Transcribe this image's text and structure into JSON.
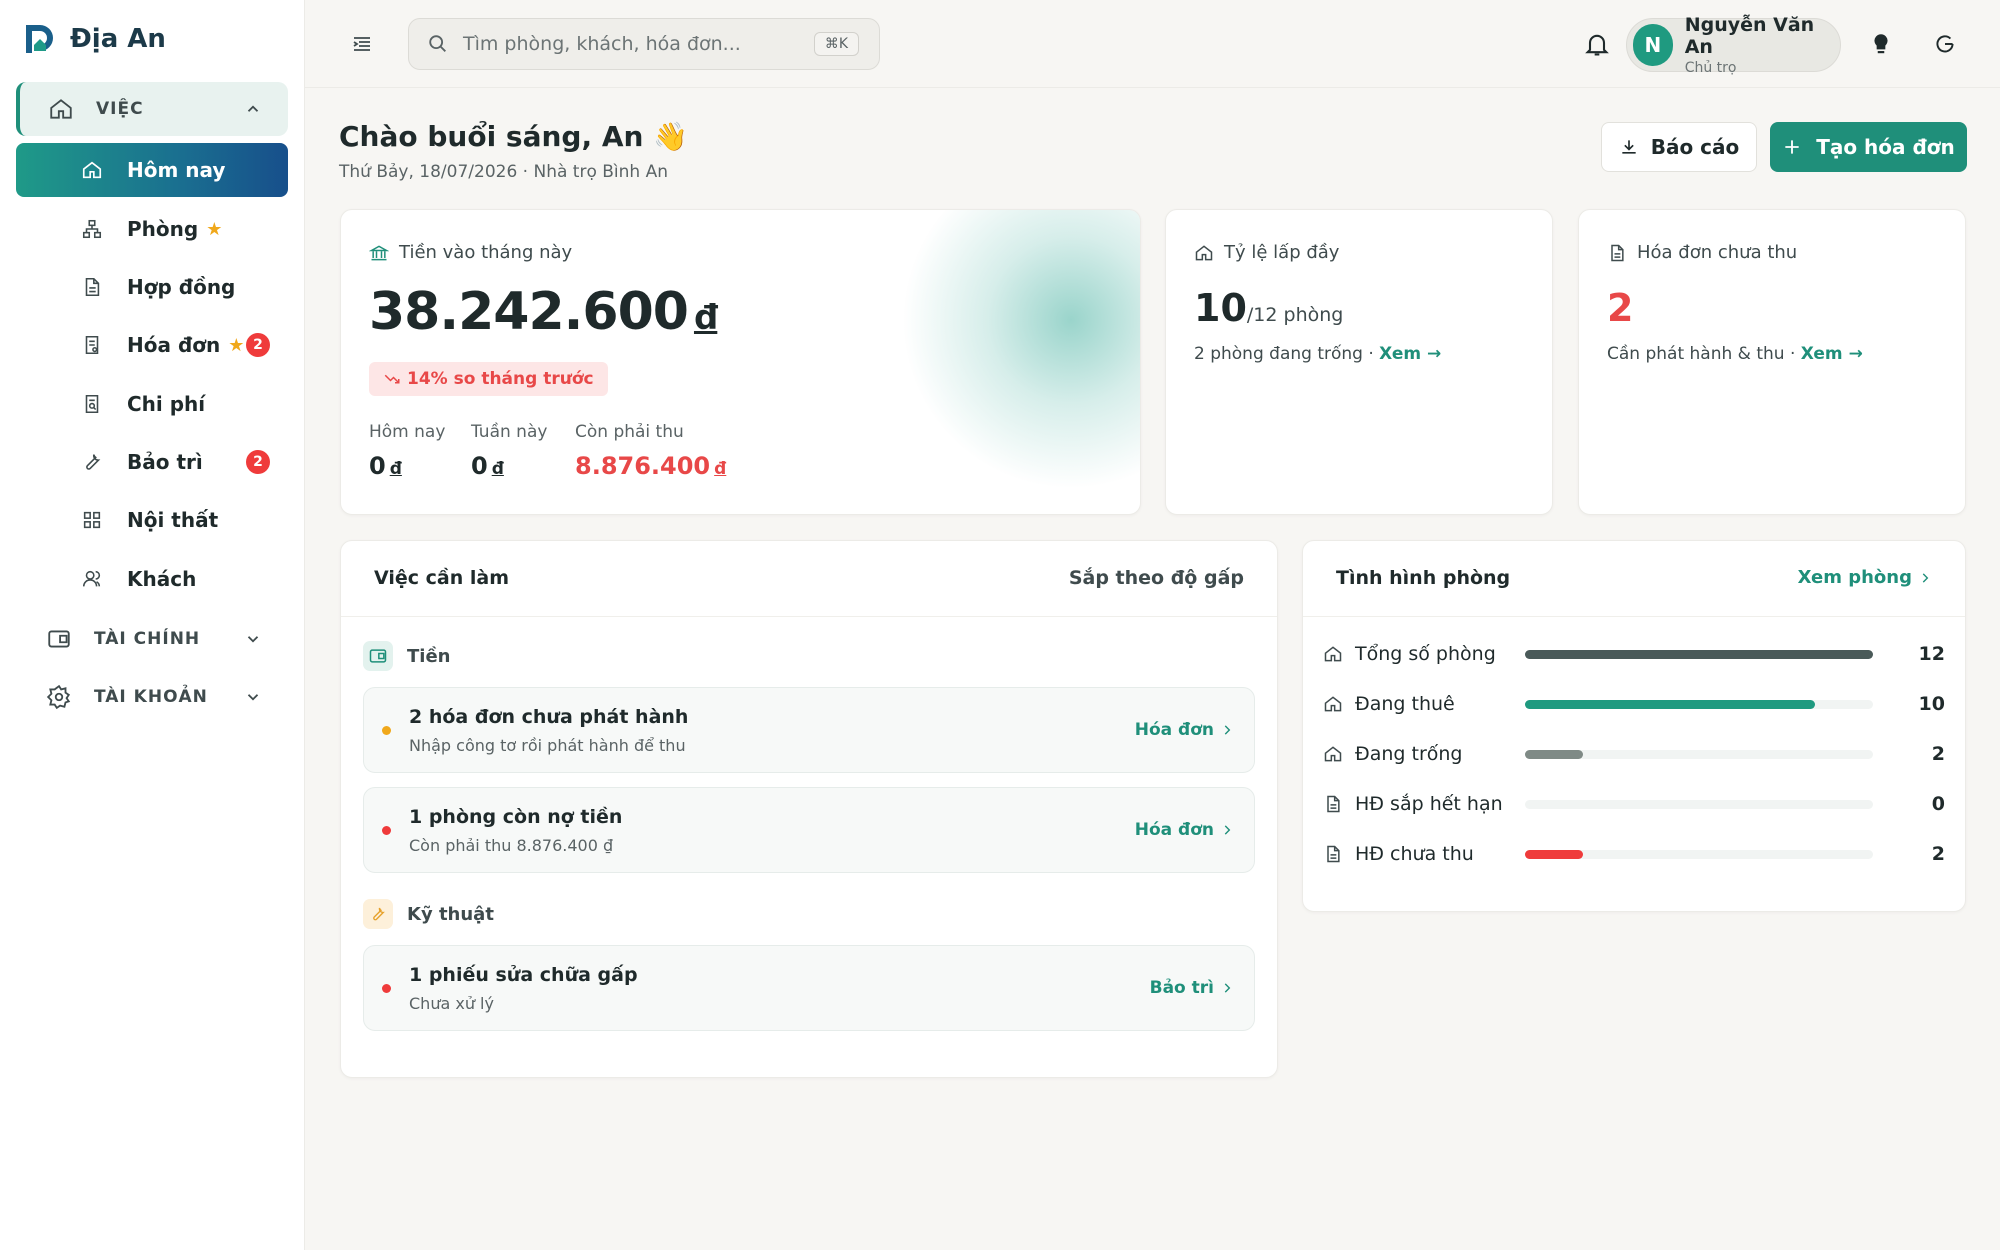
{
  "app": {
    "name": "Địa An"
  },
  "sidebar": {
    "sections": [
      {
        "label": "VIỆC"
      },
      {
        "label": "TÀI CHÍNH"
      },
      {
        "label": "TÀI KHOẢN"
      }
    ],
    "items": [
      {
        "label": "Hôm nay"
      },
      {
        "label": "Phòng",
        "starred": true
      },
      {
        "label": "Hợp đồng"
      },
      {
        "label": "Hóa đơn",
        "starred": true,
        "badge": "2"
      },
      {
        "label": "Chi phí"
      },
      {
        "label": "Bảo trì",
        "badge": "2"
      },
      {
        "label": "Nội thất"
      },
      {
        "label": "Khách"
      }
    ]
  },
  "header": {
    "search_placeholder": "Tìm phòng, khách, hóa đơn...",
    "shortcut": "⌘K",
    "user": {
      "initial": "N",
      "name": "Nguyễn Văn An",
      "role": "Chủ trọ"
    }
  },
  "greeting": {
    "title": "Chào buổi sáng, An 👋",
    "subtitle": "Thứ Bảy, 18/07/2026 · Nhà trọ Bình An",
    "report_button": "Báo cáo",
    "invoice_button": "Tạo hóa đơn"
  },
  "revenue": {
    "title": "Tiền vào tháng này",
    "amount": "38.242.600",
    "currency": "đ",
    "trend": "14% so tháng trước",
    "today_label": "Hôm nay",
    "today_value": "0",
    "week_label": "Tuần này",
    "week_value": "0",
    "due_label": "Còn phải thu",
    "due_value": "8.876.400"
  },
  "occupancy": {
    "title": "Tỷ lệ lấp đầy",
    "value": "10",
    "suffix": "/12 phòng",
    "note": "2 phòng đang trống · ",
    "link": "Xem →"
  },
  "unpaid": {
    "title": "Hóa đơn chưa thu",
    "value": "2",
    "note": "Cần phát hành & thu · ",
    "link": "Xem →"
  },
  "todo": {
    "title": "Việc cần làm",
    "sort": "Sắp theo độ gấp",
    "group_money": "Tiền",
    "group_tech": "Kỹ thuật",
    "tasks": [
      {
        "title": "2 hóa đơn chưa phát hành",
        "sub": "Nhập công tơ rồi phát hành để thu",
        "link": "Hóa đơn",
        "color": "#f0a81b"
      },
      {
        "title": "1 phòng còn nợ tiền",
        "sub": "Còn phải thu 8.876.400 ₫",
        "link": "Hóa đơn",
        "color": "#ef3b3b"
      },
      {
        "title": "1 phiếu sửa chữa gấp",
        "sub": "Chưa xử lý",
        "link": "Bảo trì",
        "color": "#ef3b3b"
      }
    ]
  },
  "rooms": {
    "title": "Tình hình phòng",
    "link": "Xem phòng",
    "rows": [
      {
        "label": "Tổng số phòng",
        "value": "12",
        "fraction": 1.0,
        "color": "#4a5a59"
      },
      {
        "label": "Đang thuê",
        "value": "10",
        "fraction": 0.833,
        "color": "#1f9a80"
      },
      {
        "label": "Đang trống",
        "value": "2",
        "fraction": 0.167,
        "color": "#7f8a86"
      },
      {
        "label": "HĐ sắp hết hạn",
        "value": "0",
        "fraction": 0,
        "color": "#1f9a80"
      },
      {
        "label": "HĐ chưa thu",
        "value": "2",
        "fraction": 0.167,
        "color": "#ef3b3b"
      }
    ]
  },
  "colors": {
    "brand": "#1f8f7a",
    "danger": "#ef3b3b",
    "star": "#f0a81b"
  }
}
